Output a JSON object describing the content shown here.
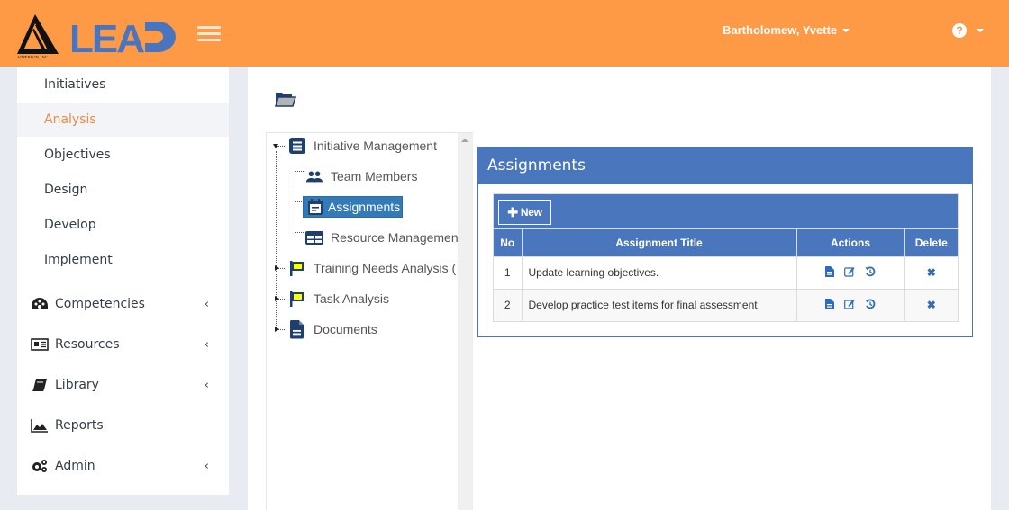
{
  "header": {
    "logo_text": "LEAD",
    "company_text": "AIMEREON, INC.",
    "user_name": "Bartholomew, Yvette",
    "help_glyph": "?"
  },
  "sidebar": {
    "sub_items": [
      {
        "label": "Initiatives",
        "active": false
      },
      {
        "label": "Analysis",
        "active": true
      },
      {
        "label": "Objectives",
        "active": false
      },
      {
        "label": "Design",
        "active": false
      },
      {
        "label": "Develop",
        "active": false
      },
      {
        "label": "Implement",
        "active": false
      }
    ],
    "top_items": [
      {
        "label": "Competencies",
        "icon": "dashboard-icon",
        "has_chevron": true
      },
      {
        "label": "Resources",
        "icon": "newspaper-icon",
        "has_chevron": true
      },
      {
        "label": "Library",
        "icon": "book-icon",
        "has_chevron": true
      },
      {
        "label": "Reports",
        "icon": "area-chart-icon",
        "has_chevron": false
      },
      {
        "label": "Admin",
        "icon": "gears-icon",
        "has_chevron": true
      }
    ],
    "chevron_glyph": "‹"
  },
  "tree": {
    "nodes": [
      {
        "label": "Initiative Management",
        "icon": "list-icon",
        "expanded": true
      },
      {
        "label": "Team Members",
        "icon": "users-icon"
      },
      {
        "label": "Assignments",
        "icon": "calendar-icon",
        "selected": true
      },
      {
        "label": "Resource Management",
        "icon": "table-icon"
      },
      {
        "label": "Training Needs Analysis (",
        "icon": "flag-icon",
        "expanded": false
      },
      {
        "label": "Task Analysis",
        "icon": "flag-icon",
        "expanded": false
      },
      {
        "label": "Documents",
        "icon": "file-icon",
        "expanded": false
      }
    ]
  },
  "panel": {
    "title": "Assignments",
    "new_button": "New",
    "columns": [
      "No",
      "Assignment Title",
      "Actions",
      "Delete"
    ],
    "rows": [
      {
        "no": "1",
        "title": "Update learning objectives."
      },
      {
        "no": "2",
        "title": "Develop practice test items for final assessment"
      }
    ],
    "delete_glyph": "✖"
  },
  "colors": {
    "header_bg": "#fe9a46",
    "brand_blue": "#4a76bd",
    "active_text": "#f08b3c",
    "selected_node": "#337ab7",
    "flag_yellow": "#ffff00",
    "icon_navy": "#1f3f6e"
  }
}
